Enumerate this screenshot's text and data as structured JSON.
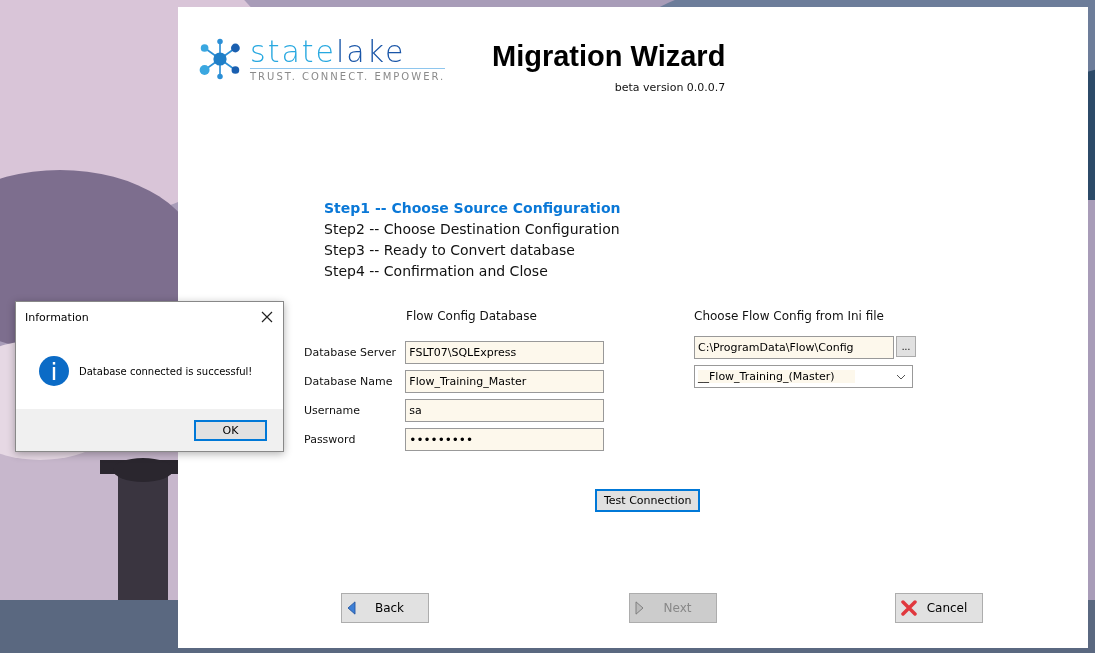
{
  "logo": {
    "wordmark_light": "state",
    "wordmark_dark": "lake",
    "tagline": "TRUST. CONNECT. EMPOWER."
  },
  "title": "Migration Wizard",
  "version": "beta version 0.0.0.7",
  "steps": [
    {
      "label": "Step1 -- Choose Source Configuration",
      "selected": true
    },
    {
      "label": "Step2 -- Choose Destination Configuration",
      "selected": false
    },
    {
      "label": "Step3 -- Ready to Convert database",
      "selected": false
    },
    {
      "label": "Step4 -- Confirmation and Close",
      "selected": false
    }
  ],
  "source": {
    "heading": "Flow Config Database",
    "fields": [
      {
        "label": "Database Server",
        "value": "FSLT07\\SQLExpress",
        "kind": "text"
      },
      {
        "label": "Database Name",
        "value": "Flow_Training_Master",
        "kind": "text"
      },
      {
        "label": "Username",
        "value": "sa",
        "kind": "text"
      },
      {
        "label": "Password",
        "value": "•••••••••",
        "kind": "password"
      }
    ]
  },
  "ini": {
    "heading": "Choose Flow Config from Ini file",
    "path": "C:\\ProgramData\\Flow\\Config",
    "browse_label": "...",
    "selection": "__Flow_Training_(Master)"
  },
  "test_button": {
    "label": "Test Connection",
    "focused": true
  },
  "nav": [
    {
      "label": "Back",
      "kind": "back",
      "disabled": false
    },
    {
      "label": "Next",
      "kind": "next",
      "disabled": true
    },
    {
      "label": "Cancel",
      "kind": "cancel",
      "disabled": false
    }
  ],
  "dialog": {
    "title": "Information",
    "message": "Database connected is successful!",
    "ok_label": "OK",
    "ok_focused": true
  }
}
